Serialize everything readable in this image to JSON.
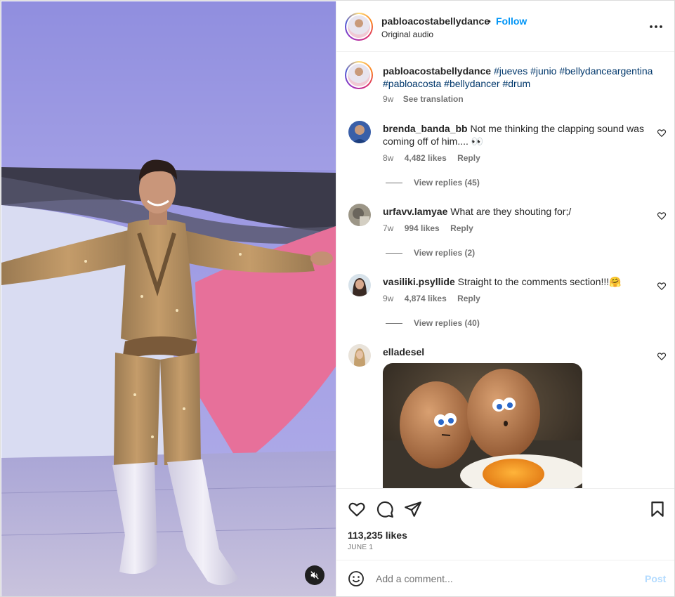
{
  "header": {
    "username": "pabloacostabellydance",
    "separator": "•",
    "follow_label": "Follow",
    "audio_label": "Original audio",
    "more_icon": "more-horizontal-icon"
  },
  "caption": {
    "username": "pabloacostabellydance",
    "hashtags_line1": "#jueves #junio #bellydanceargentina",
    "hashtags_line2": "#pabloacosta #bellydancer #drum",
    "time": "9w",
    "see_translation": "See translation"
  },
  "comments": [
    {
      "username": "brenda_banda_bb",
      "text": "Not me thinking the clapping sound was coming off of him.... 👀",
      "time": "8w",
      "likes": "4,482 likes",
      "reply": "Reply",
      "view_replies": "View replies (45)"
    },
    {
      "username": "urfavv.lamyae",
      "text": "What are they shouting for;/",
      "time": "7w",
      "likes": "994 likes",
      "reply": "Reply",
      "view_replies": "View replies (2)"
    },
    {
      "username": "vasiliki.psyllide",
      "text": "Straight to the comments section!!!🤗",
      "time": "9w",
      "likes": "4,874 likes",
      "reply": "Reply",
      "view_replies": "View replies (40)"
    },
    {
      "username": "elladesel",
      "text": "",
      "image": "eggs-cartoon-image"
    }
  ],
  "actions": {
    "like_icon": "heart-icon",
    "comment_icon": "comment-icon",
    "share_icon": "send-icon",
    "save_icon": "bookmark-icon",
    "likes_count": "113,235 likes",
    "date": "JUNE 1"
  },
  "add_comment": {
    "placeholder": "Add a comment...",
    "post_label": "Post",
    "emoji_icon": "emoji-icon"
  },
  "media": {
    "mute_icon": "speaker-muted-icon"
  },
  "colors": {
    "link_blue": "#0095f6",
    "hashtag_blue": "#00376b",
    "secondary_text": "#737373",
    "post_disabled": "#b3dbff"
  }
}
